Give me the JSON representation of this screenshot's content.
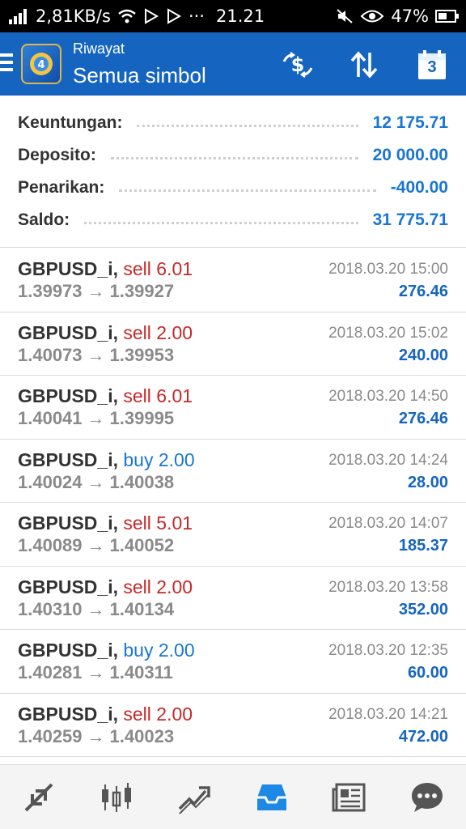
{
  "status_bar": {
    "speed": "2,81KB/s",
    "dots": "···",
    "time": "21.21",
    "battery": "47%"
  },
  "header": {
    "subtitle": "Riwayat",
    "title": "Semua simbol",
    "calendar_day": "3"
  },
  "summary": [
    {
      "label": "Keuntungan:",
      "value": "12 175.71"
    },
    {
      "label": "Deposito:",
      "value": "20 000.00"
    },
    {
      "label": "Penarikan:",
      "value": "-400.00"
    },
    {
      "label": "Saldo:",
      "value": "31 775.71"
    }
  ],
  "deals": [
    {
      "symbol": "GBPUSD_i,",
      "type": "sell",
      "volume": "sell 6.01",
      "open": "1.39973",
      "arrow": "→",
      "close": "1.39927",
      "time": "2018.03.20 15:00",
      "profit": "276.46"
    },
    {
      "symbol": "GBPUSD_i,",
      "type": "sell",
      "volume": "sell 2.00",
      "open": "1.40073",
      "arrow": "→",
      "close": "1.39953",
      "time": "2018.03.20 15:02",
      "profit": "240.00"
    },
    {
      "symbol": "GBPUSD_i,",
      "type": "sell",
      "volume": "sell 6.01",
      "open": "1.40041",
      "arrow": "→",
      "close": "1.39995",
      "time": "2018.03.20 14:50",
      "profit": "276.46"
    },
    {
      "symbol": "GBPUSD_i,",
      "type": "buy",
      "volume": "buy 2.00",
      "open": "1.40024",
      "arrow": "→",
      "close": "1.40038",
      "time": "2018.03.20 14:24",
      "profit": "28.00"
    },
    {
      "symbol": "GBPUSD_i,",
      "type": "sell",
      "volume": "sell 5.01",
      "open": "1.40089",
      "arrow": "→",
      "close": "1.40052",
      "time": "2018.03.20 14:07",
      "profit": "185.37"
    },
    {
      "symbol": "GBPUSD_i,",
      "type": "sell",
      "volume": "sell 2.00",
      "open": "1.40310",
      "arrow": "→",
      "close": "1.40134",
      "time": "2018.03.20 13:58",
      "profit": "352.00"
    },
    {
      "symbol": "GBPUSD_i,",
      "type": "buy",
      "volume": "buy 2.00",
      "open": "1.40281",
      "arrow": "→",
      "close": "1.40311",
      "time": "2018.03.20 12:35",
      "profit": "60.00"
    },
    {
      "symbol": "GBPUSD_i,",
      "type": "sell",
      "volume": "sell 2.00",
      "open": "1.40259",
      "arrow": "→",
      "close": "1.40023",
      "time": "2018.03.20 14:21",
      "profit": "472.00"
    }
  ],
  "bottom_nav": [
    {
      "name": "quotes-icon"
    },
    {
      "name": "chart-icon"
    },
    {
      "name": "trade-icon"
    },
    {
      "name": "history-icon",
      "active": true
    },
    {
      "name": "news-icon"
    },
    {
      "name": "chat-icon"
    }
  ],
  "colors": {
    "appbar": "#1565c0",
    "sell": "#c62828",
    "buy": "#1976d2",
    "profit": "#1565c0",
    "active_nav": "#1e88e5",
    "nav_icon": "#555555"
  }
}
